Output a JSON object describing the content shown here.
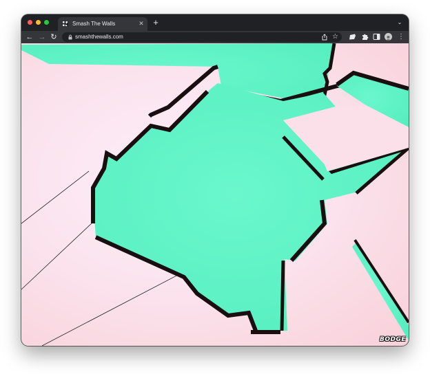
{
  "browser": {
    "tab": {
      "title": "Smash The Walls",
      "favicon": "smash-the-walls-logo"
    },
    "new_tab_glyph": "+",
    "address_bar": {
      "url": "smashthewalls.com",
      "secure": true
    },
    "controls": {
      "back": "←",
      "forward": "→",
      "reload": "↻",
      "star": "☆",
      "menu": "⋮",
      "tab_search": "⌄",
      "close": "✕"
    }
  },
  "game": {
    "badge": "BODGE",
    "colors": {
      "background_light": "#fdeefa",
      "background_pink": "#f9d0d9",
      "hole_fill": "#66f5c8",
      "crack_edge": "#1a0f10"
    }
  }
}
